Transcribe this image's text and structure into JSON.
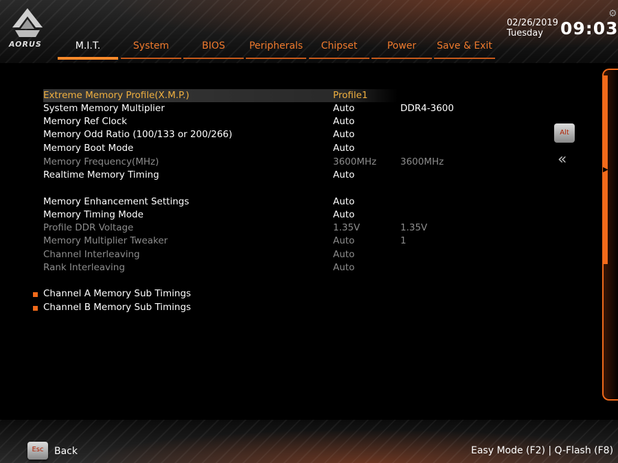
{
  "brand": {
    "logo_text": "AORUS"
  },
  "tabs": [
    {
      "label": "M.I.T.",
      "active": true
    },
    {
      "label": "System"
    },
    {
      "label": "BIOS"
    },
    {
      "label": "Peripherals"
    },
    {
      "label": "Chipset"
    },
    {
      "label": "Power"
    },
    {
      "label": "Save & Exit"
    }
  ],
  "clock": {
    "date": "02/26/2019",
    "day": "Tuesday",
    "time": "09:03"
  },
  "settings": [
    {
      "label": "Extreme Memory Profile(X.M.P.)",
      "value": "Profile1",
      "current": ""
    },
    {
      "label": "System Memory Multiplier",
      "value": "Auto",
      "current": "DDR4-3600"
    },
    {
      "label": "Memory Ref Clock",
      "value": "Auto",
      "current": ""
    },
    {
      "label": "Memory Odd Ratio (100/133 or 200/266)",
      "value": "Auto",
      "current": ""
    },
    {
      "label": "Memory Boot Mode",
      "value": "Auto",
      "current": ""
    },
    {
      "label": "Memory Frequency(MHz)",
      "value": "3600MHz",
      "current": "3600MHz"
    },
    {
      "label": "Realtime Memory Timing",
      "value": "Auto",
      "current": ""
    },
    {
      "label": "Memory Enhancement Settings",
      "value": "Auto",
      "current": ""
    },
    {
      "label": "Memory Timing Mode",
      "value": "Auto",
      "current": ""
    },
    {
      "label": "Profile DDR Voltage",
      "value": "1.35V",
      "current": "1.35V"
    },
    {
      "label": "Memory Multiplier Tweaker",
      "value": "Auto",
      "current": "1"
    },
    {
      "label": "Channel Interleaving",
      "value": "Auto",
      "current": ""
    },
    {
      "label": "Rank Interleaving",
      "value": "Auto",
      "current": ""
    }
  ],
  "submenus": [
    {
      "label": "Channel A Memory Sub Timings"
    },
    {
      "label": "Channel B Memory Sub Timings"
    }
  ],
  "side": {
    "alt_key": "Alt",
    "collapse_glyph": "«"
  },
  "footer": {
    "esc_key": "Esc",
    "back_label": "Back",
    "right_text": "Easy Mode (F2)  |  Q-Flash (F8)"
  },
  "colors": {
    "accent": "#f26a1a",
    "highlight_text": "#f0b040",
    "tab_text": "#f07a2c",
    "dim_text": "#8c8c8c"
  }
}
